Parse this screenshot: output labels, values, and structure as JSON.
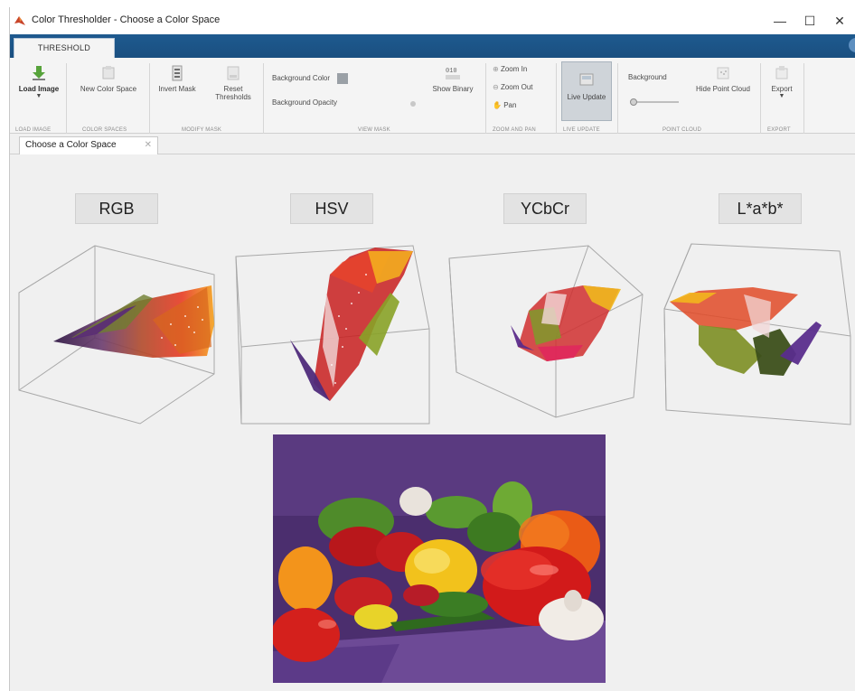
{
  "window": {
    "title": "Color Thresholder - Choose a Color Space",
    "controls": {
      "minimize": "—",
      "maximize": "☐",
      "close": "✕"
    }
  },
  "ribbon": {
    "tab_label": "THRESHOLD",
    "buttons": {
      "load_image": "Load Image",
      "new_color_space": "New Color Space",
      "invert_mask": "Invert Mask",
      "reset_line1": "Reset",
      "reset_line2": "Thresholds",
      "background_color": "Background Color",
      "background_opacity": "Background Opacity",
      "show_binary": "Show Binary",
      "zoom_in": "Zoom In",
      "zoom_out": "Zoom Out",
      "pan": "Pan",
      "live_update": "Live Update",
      "background": "Background",
      "hide_point_cloud": "Hide Point Cloud",
      "export": "Export"
    },
    "sections": {
      "load_image": "LOAD IMAGE",
      "color_spaces": "COLOR SPACES",
      "modify_mask": "MODIFY MASK",
      "view_mask": "VIEW MASK",
      "zoom_and_pan": "ZOOM AND PAN",
      "live_update": "LIVE UPDATE",
      "point_cloud": "POINT CLOUD",
      "export": "EXPORT"
    },
    "colors": {
      "band": "#1e5a8f",
      "swatch": "#9aa0a6"
    }
  },
  "document": {
    "tab_label": "Choose a Color Space",
    "close_glyph": "✕"
  },
  "color_spaces": [
    {
      "label": "RGB"
    },
    {
      "label": "HSV"
    },
    {
      "label": "YCbCr"
    },
    {
      "label": "L*a*b*"
    }
  ]
}
